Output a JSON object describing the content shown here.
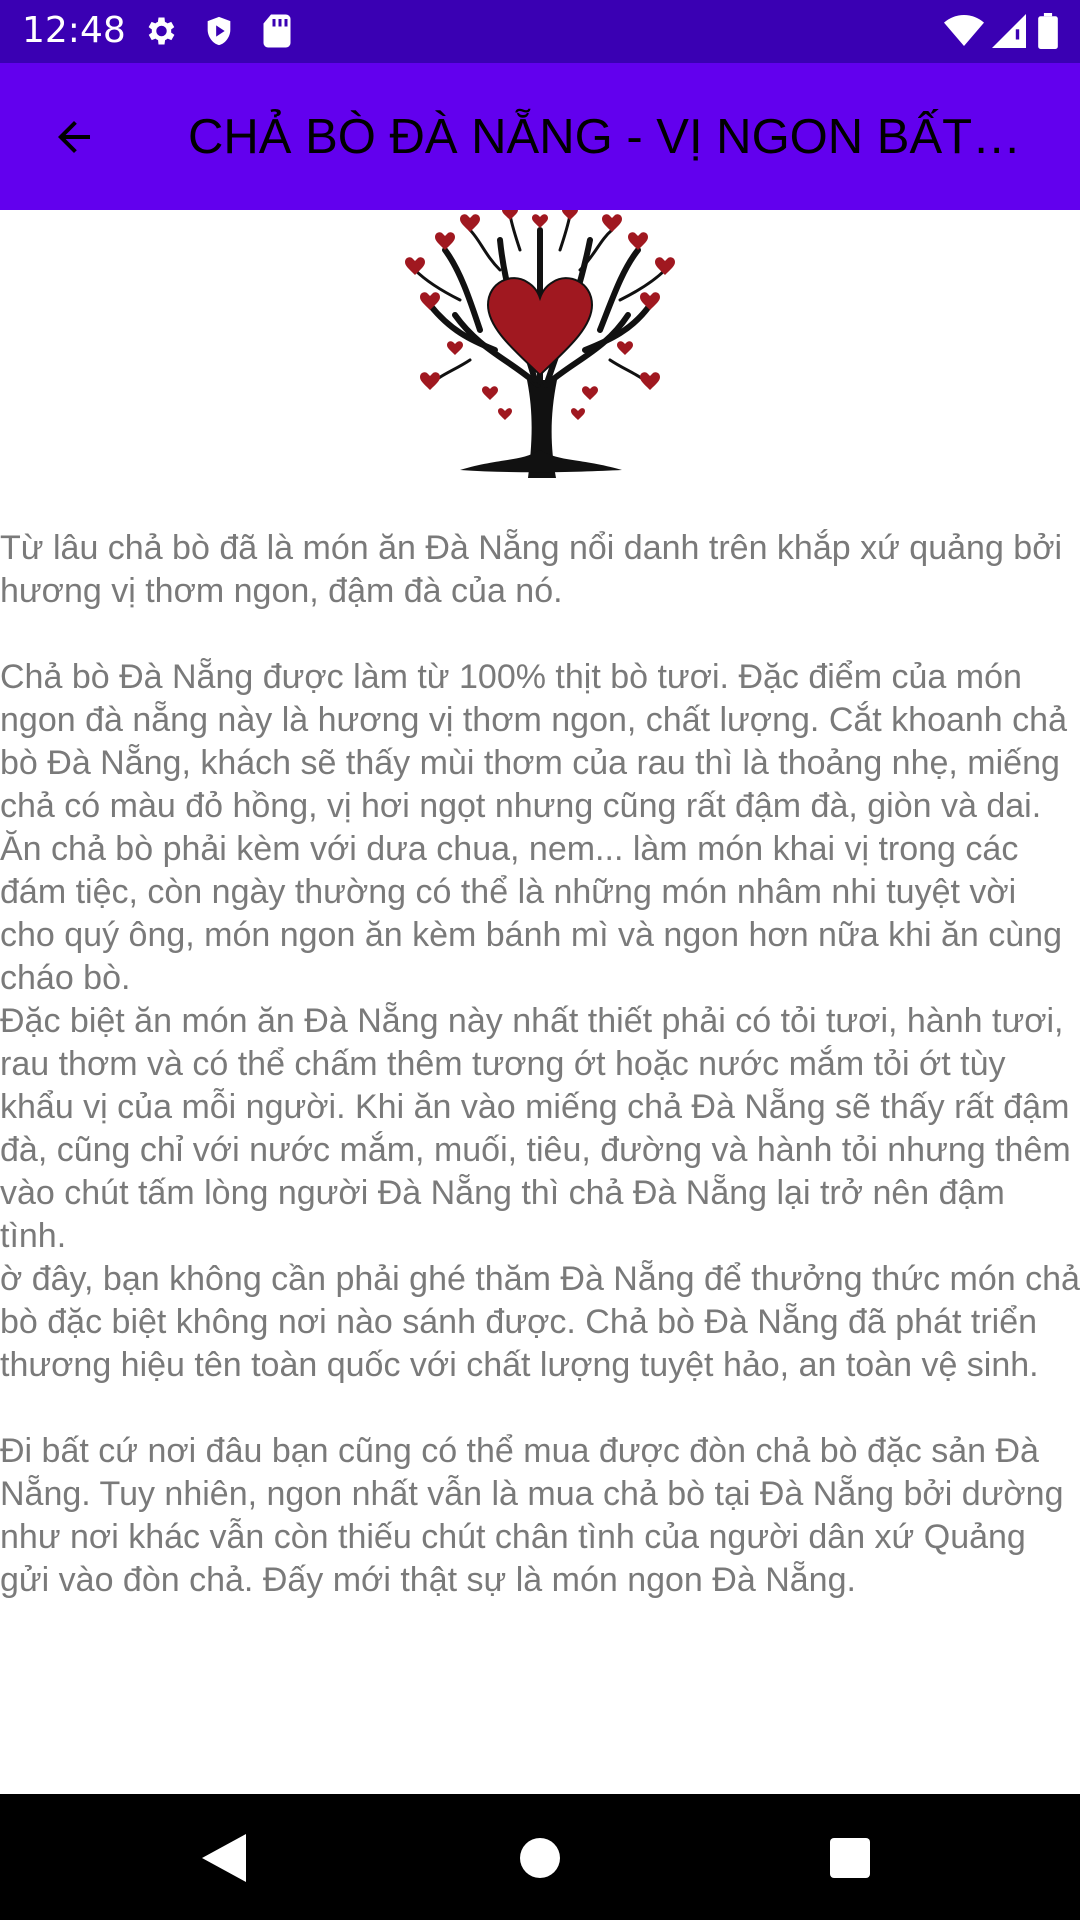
{
  "status_bar": {
    "time": "12:48",
    "left_icons": [
      "gear-icon",
      "shield-icon",
      "sd-card-icon"
    ],
    "right_icons": [
      "wifi-icon",
      "signal-icon",
      "battery-icon"
    ]
  },
  "app_bar": {
    "back_icon": "arrow-back-icon",
    "title": "CHẢ BÒ ĐÀ NẴNG - VỊ NGON BẤT…",
    "color": "#6200ee"
  },
  "hero_image": {
    "icon": "heart-tree-icon",
    "heart_color": "#a01820"
  },
  "article": {
    "paragraphs": [
      "Từ lâu chả bò đã là món ăn Đà Nẵng nổi danh trên khắp xứ quảng bởi hương vị thơm ngon, đậm đà của nó.",
      "Chả bò Đà Nẵng được làm từ 100% thịt bò tươi. Đặc điểm của món ngon đà nẵng này là hương vị thơm ngon, chất lượng. Cắt khoanh chả bò Đà Nẵng, khách sẽ thấy mùi thơm của rau thì là thoảng nhẹ, miếng chả có màu đỏ hồng, vị hơi ngọt nhưng cũng rất đậm đà, giòn và dai. Ăn chả bò phải kèm với dưa chua, nem... làm món khai vị trong các đám tiệc, còn ngày thường có thể là những món nhâm nhi tuyệt vời cho quý ông, món ngon ăn kèm bánh mì và ngon hơn nữa khi ăn cùng cháo bò.",
      "Đặc biệt ăn món ăn Đà Nẵng này nhất thiết phải có tỏi tươi, hành tươi, rau thơm và có thể chấm thêm tương ớt hoặc nước mắm tỏi ớt tùy khẩu vị của mỗi người. Khi ăn vào miếng chả Đà Nẵng sẽ thấy rất đậm đà, cũng chỉ với nước mắm, muối, tiêu, đường và hành tỏi nhưng thêm vào chút tấm lòng người Đà Nẵng thì chả Đà Nẵng lại trở nên đậm tình.",
      "ờ đây, bạn không cần phải ghé thăm Đà Nẵng để thưởng thức món chả bò đặc biệt không nơi nào sánh được. Chả bò Đà Nẵng đã phát triển thương hiệu tên toàn quốc với chất lượng tuyệt hảo, an toàn vệ sinh.",
      "Đi bất cứ nơi đâu bạn cũng có thể mua được đòn chả bò đặc sản Đà Nẵng. Tuy nhiên, ngon nhất vẫn là mua chả bò tại Đà Nẵng bởi dường như nơi khác vẫn còn thiếu chút chân tình của người dân xứ Quảng gửi vào đòn chả. Đấy mới thật sự là món ngon Đà Nẵng."
    ]
  },
  "nav_bar": {
    "icons": [
      "back-triangle-icon",
      "home-circle-icon",
      "recents-square-icon"
    ]
  }
}
